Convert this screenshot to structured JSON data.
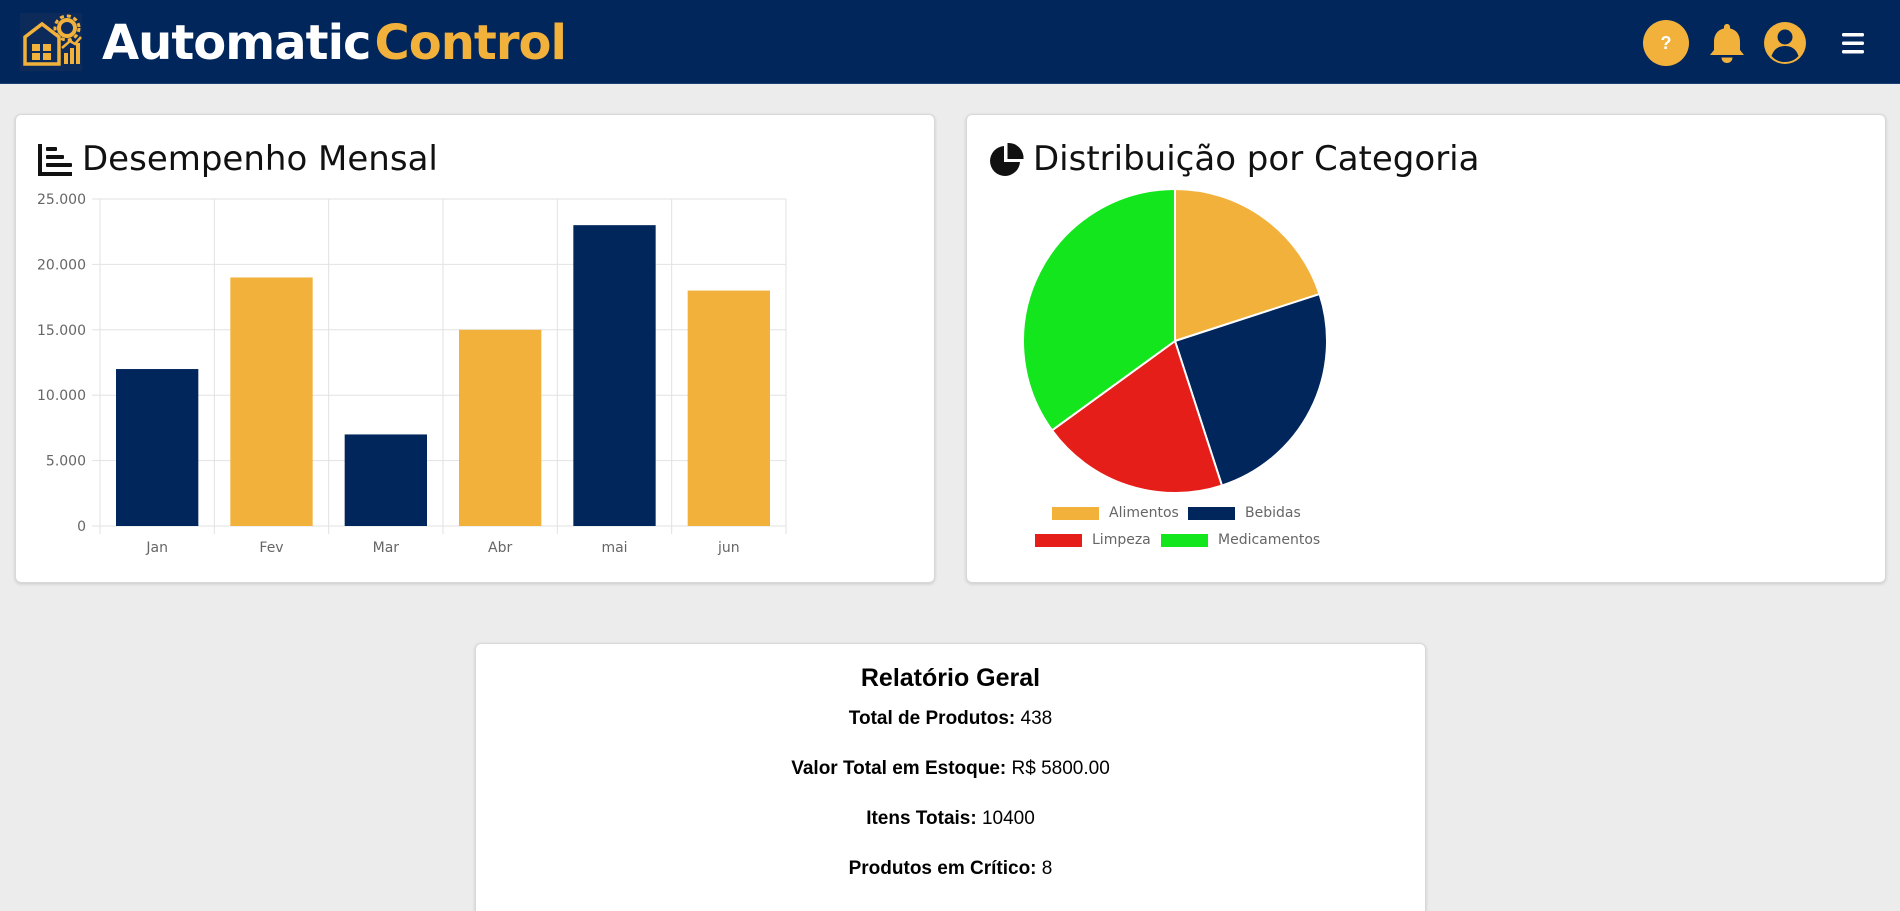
{
  "app": {
    "brand_part1": "Automatic",
    "brand_part2": "Control",
    "help_label": "?",
    "colors": {
      "navy": "#00265c",
      "accent": "#f2b13b",
      "red": "#e61e19",
      "green": "#14e61e"
    }
  },
  "bar_card": {
    "title": "Desempenho Mensal",
    "icon": "bar-chart-icon"
  },
  "pie_card": {
    "title": "Distribuição por Categoria",
    "icon": "pie-chart-icon"
  },
  "report": {
    "title": "Relatório Geral",
    "items": [
      {
        "label": "Total de Produtos:",
        "value": "438"
      },
      {
        "label": "Valor Total em Estoque:",
        "value": "R$ 5800.00"
      },
      {
        "label": "Itens Totais:",
        "value": "10400"
      },
      {
        "label": "Produtos em Crítico:",
        "value": "8"
      }
    ]
  },
  "chart_data": [
    {
      "type": "bar",
      "categories": [
        "Jan",
        "Fev",
        "Mar",
        "Abr",
        "mai",
        "jun"
      ],
      "values": [
        12000,
        19000,
        7000,
        15000,
        23000,
        18000
      ],
      "colors": [
        "#00265c",
        "#f2b13b",
        "#00265c",
        "#f2b13b",
        "#00265c",
        "#f2b13b"
      ],
      "ylim": [
        0,
        25000
      ],
      "yticks": [
        0,
        5000,
        10000,
        15000,
        20000,
        25000
      ],
      "ytick_labels": [
        "0",
        "5.000",
        "10.000",
        "15.000",
        "20.000",
        "25.000"
      ],
      "grid": true,
      "legend": "none"
    },
    {
      "type": "pie",
      "series": [
        {
          "name": "Alimentos",
          "value": 20,
          "color": "#f2b13b"
        },
        {
          "name": "Bebidas",
          "value": 25,
          "color": "#00265c"
        },
        {
          "name": "Limpeza",
          "value": 20,
          "color": "#e61e19"
        },
        {
          "name": "Medicamentos",
          "value": 35,
          "color": "#14e61e"
        }
      ],
      "legend": "bottom"
    }
  ]
}
